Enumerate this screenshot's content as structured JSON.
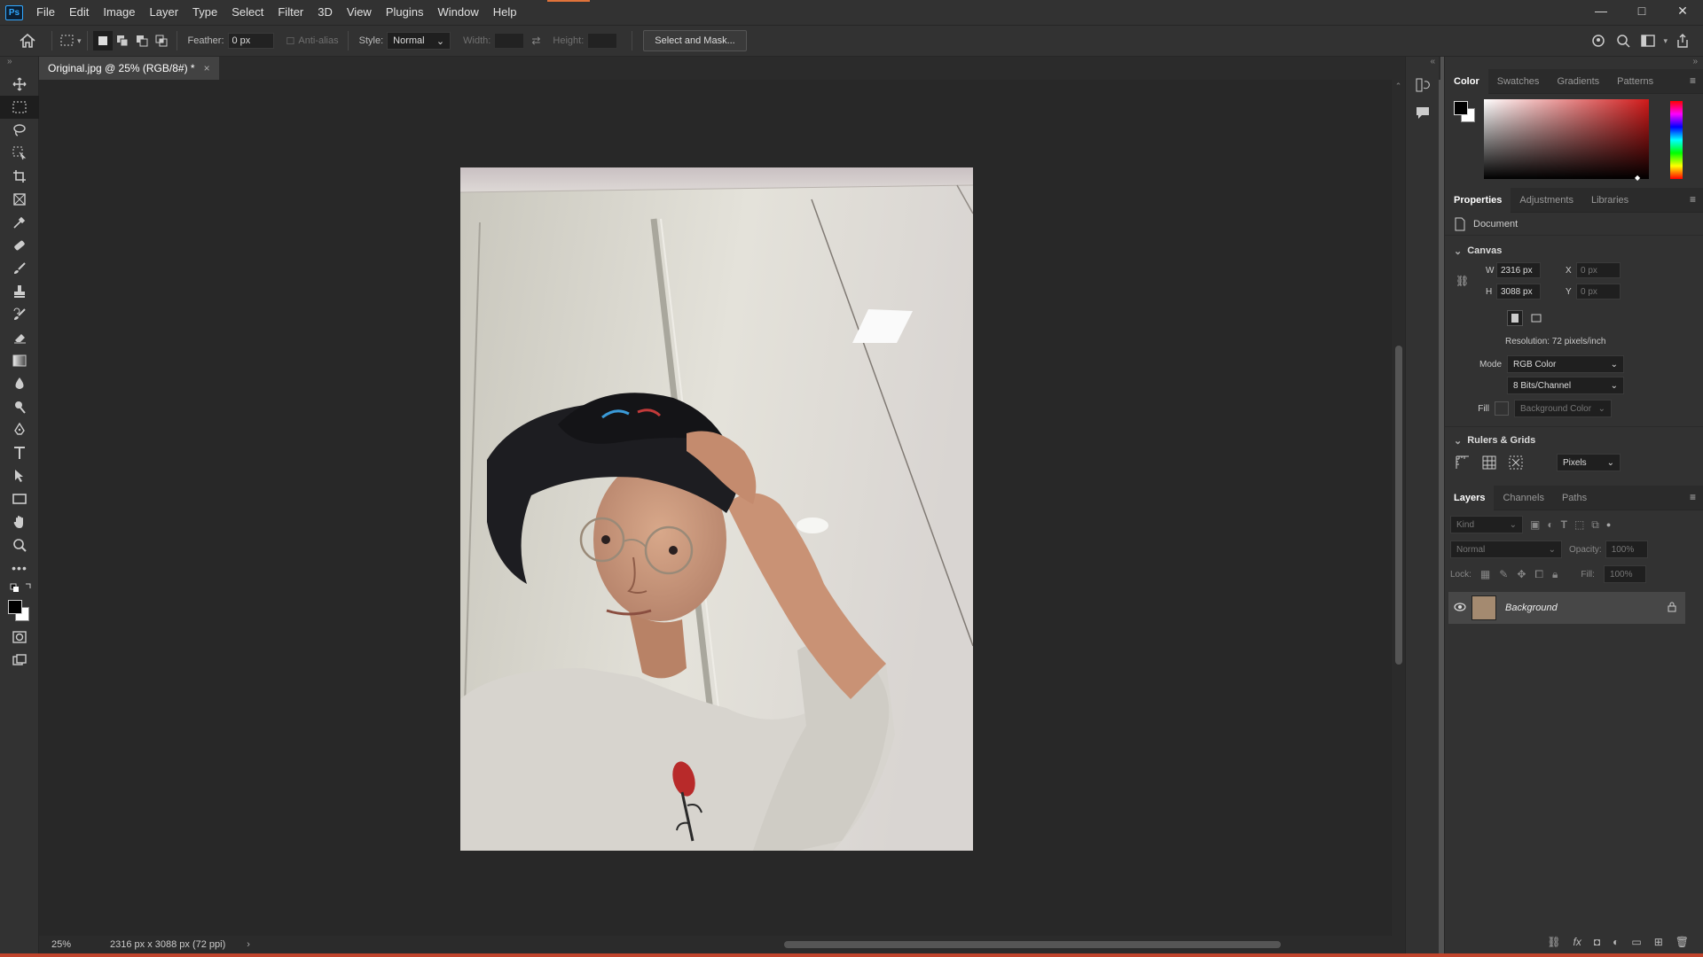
{
  "app": {
    "logo": "Ps"
  },
  "menu": [
    "File",
    "Edit",
    "Image",
    "Layer",
    "Type",
    "Select",
    "Filter",
    "3D",
    "View",
    "Plugins",
    "Window",
    "Help"
  ],
  "window_controls": {
    "minimize": "—",
    "maximize": "□",
    "close": "✕"
  },
  "options": {
    "feather_label": "Feather:",
    "feather_value": "0 px",
    "antialias_label": "Anti-alias",
    "style_label": "Style:",
    "style_value": "Normal",
    "width_label": "Width:",
    "height_label": "Height:",
    "select_mask_label": "Select and Mask..."
  },
  "document": {
    "tab_title": "Original.jpg @ 25% (RGB/8#) *",
    "close": "×"
  },
  "status": {
    "zoom": "25%",
    "info": "2316 px x 3088 px (72 ppi)",
    "arrow": "›"
  },
  "color_panel": {
    "tabs": [
      "Color",
      "Swatches",
      "Gradients",
      "Patterns"
    ],
    "accent_color": "#d11a1a"
  },
  "properties_panel": {
    "tabs": [
      "Properties",
      "Adjustments",
      "Libraries"
    ],
    "doc_label": "Document",
    "canvas_title": "Canvas",
    "w_label": "W",
    "w_value": "2316 px",
    "h_label": "H",
    "h_value": "3088 px",
    "x_label": "X",
    "x_placeholder": "0 px",
    "y_label": "Y",
    "y_placeholder": "0 px",
    "resolution": "Resolution: 72 pixels/inch",
    "mode_label": "Mode",
    "mode_value": "RGB Color",
    "bits_value": "8 Bits/Channel",
    "fill_label": "Fill",
    "fill_value": "Background Color",
    "rulers_title": "Rulers & Grids",
    "units_value": "Pixels"
  },
  "layers_panel": {
    "tabs": [
      "Layers",
      "Channels",
      "Paths"
    ],
    "kind_placeholder": "Kind",
    "blend_value": "Normal",
    "opacity_label": "Opacity:",
    "opacity_value": "100%",
    "lock_label": "Lock:",
    "fill_label": "Fill:",
    "fill_value": "100%",
    "layer_name": "Background"
  }
}
